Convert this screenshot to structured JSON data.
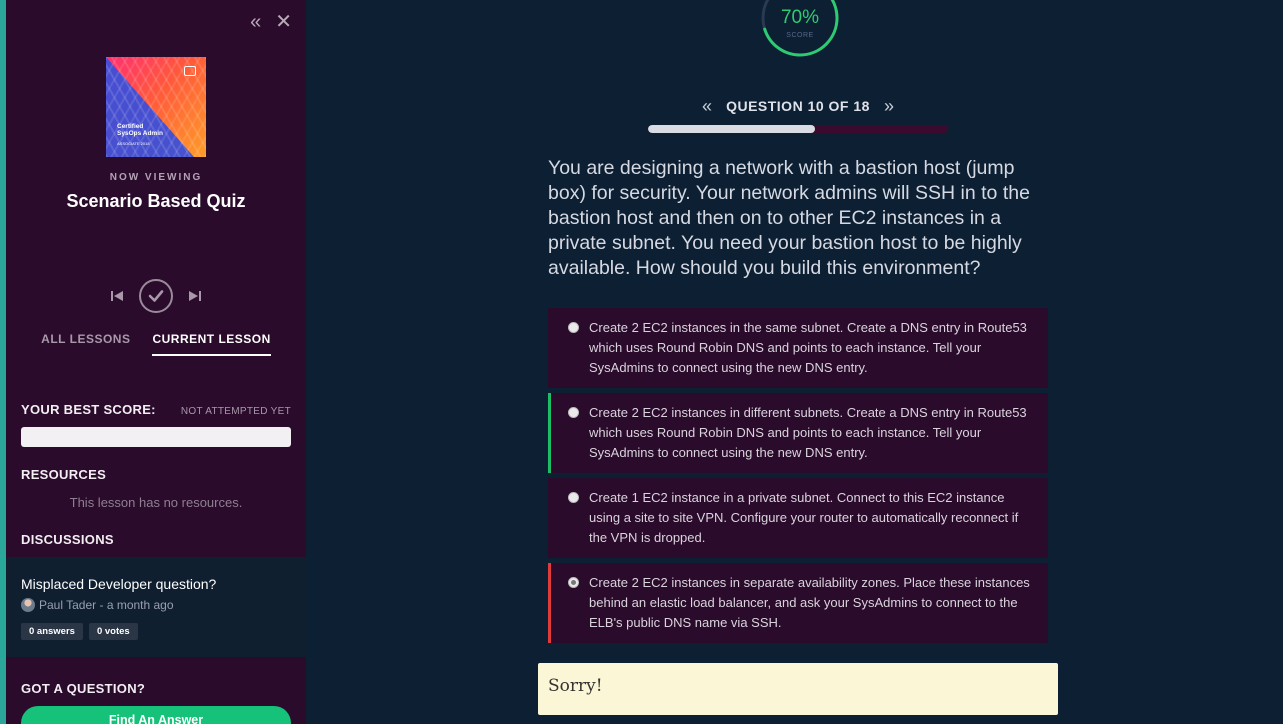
{
  "sidebar": {
    "collapse_icon": "double-chevron-left-icon",
    "close_icon": "close-icon",
    "course_cover": {
      "line1": "Certified",
      "line2": "SysOps Admin",
      "line3": "ASSOCIATE 2018"
    },
    "now_viewing_label": "NOW VIEWING",
    "lesson_title": "Scenario Based Quiz",
    "tabs": [
      {
        "label": "ALL LESSONS",
        "active": false
      },
      {
        "label": "CURRENT LESSON",
        "active": true
      }
    ],
    "best_score_label": "YOUR BEST SCORE:",
    "best_score_status": "NOT ATTEMPTED YET",
    "resources_label": "RESOURCES",
    "no_resources_text": "This lesson has no resources.",
    "discussions_label": "DISCUSSIONS",
    "discussion": {
      "title": "Misplaced Developer question?",
      "meta": "Paul Tader - a month ago",
      "answers": "0 answers",
      "votes": "0 votes"
    },
    "got_question_label": "GOT A QUESTION?",
    "find_answer_button": "Find An Answer"
  },
  "quiz": {
    "score_percent": "70%",
    "score_fraction": 0.7,
    "score_label": "SCORE",
    "question_label": "QUESTION 10 OF 18",
    "question_progress": 0.555,
    "question_text": "You are designing a network with a bastion host (jump box) for security. Your network admins will SSH in to the bastion host and then on to other EC2 instances in a private subnet. You need your bastion host to be highly available. How should you build this environment?",
    "answers": [
      {
        "text": "Create 2 EC2 instances in the same subnet. Create a DNS entry in Route53 which uses Round Robin DNS and points to each instance. Tell your SysAdmins to connect using the new DNS entry.",
        "state": "none"
      },
      {
        "text": "Create 2 EC2 instances in different subnets. Create a DNS entry in Route53 which uses Round Robin DNS and points to each instance. Tell your SysAdmins to connect using the new DNS entry.",
        "state": "correct"
      },
      {
        "text": "Create 1 EC2 instance in a private subnet. Connect to this EC2 instance using a site to site VPN. Configure your router to automatically reconnect if the VPN is dropped.",
        "state": "none"
      },
      {
        "text": "Create 2 EC2 instances in separate availability zones. Place these instances behind an elastic load balancer, and ask your SysAdmins to connect to the ELB's public DNS name via SSH.",
        "state": "wrong",
        "selected": true
      }
    ],
    "feedback": "Sorry!"
  },
  "colors": {
    "sidebar_bg": "#2b0b2c",
    "main_bg": "#0c1f33",
    "correct": "#1bbd67",
    "wrong": "#e03a3a",
    "score_ring": "#2ecc71",
    "cta": "#16c27a"
  }
}
